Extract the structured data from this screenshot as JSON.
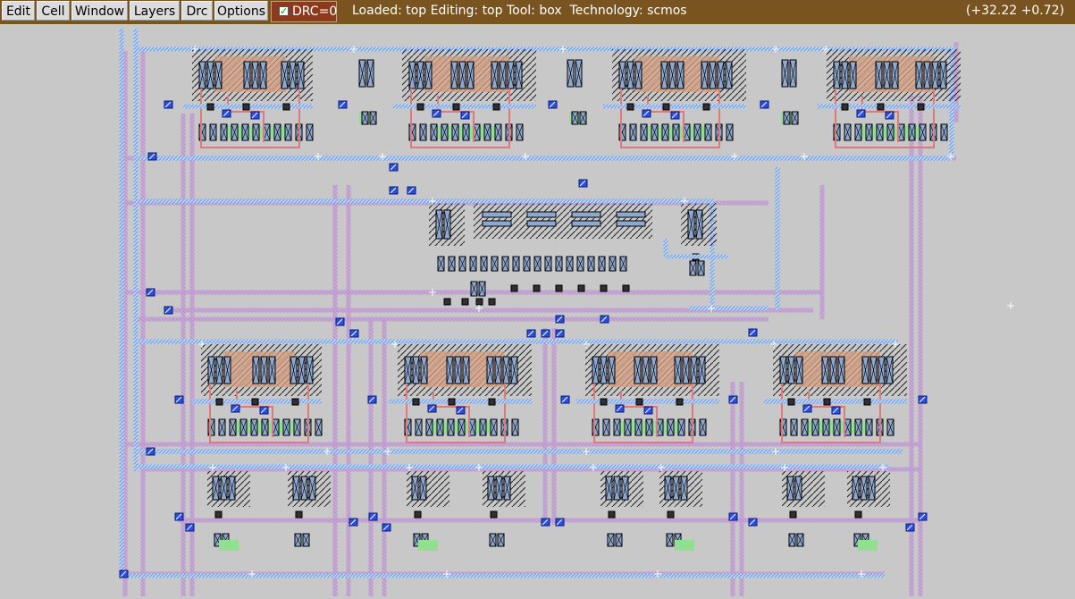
{
  "menu": {
    "items": [
      {
        "id": "edit",
        "label": "Edit"
      },
      {
        "id": "cell",
        "label": "Cell"
      },
      {
        "id": "window",
        "label": "Window"
      },
      {
        "id": "layers",
        "label": "Layers"
      },
      {
        "id": "drc",
        "label": "Drc"
      },
      {
        "id": "options",
        "label": "Options"
      }
    ]
  },
  "drc_toggle": {
    "label": "DRC=0",
    "checked": true
  },
  "status": {
    "text": "Loaded: top Editing: top Tool: box  Technology: scmos",
    "coords": "(+32.22 +0.72)"
  },
  "colors": {
    "menubar": "#7a5420",
    "canvas_bg": "#c8c8c8",
    "metal1": "#7fa8ee",
    "metal2": "#c8a0d8",
    "poly": "#e08080",
    "diffusion": "#d4a080",
    "active": "#90e090",
    "contact": "#1030c0"
  },
  "icons": {
    "drc_check": "check-icon",
    "cursor": "crosshair-icon"
  }
}
